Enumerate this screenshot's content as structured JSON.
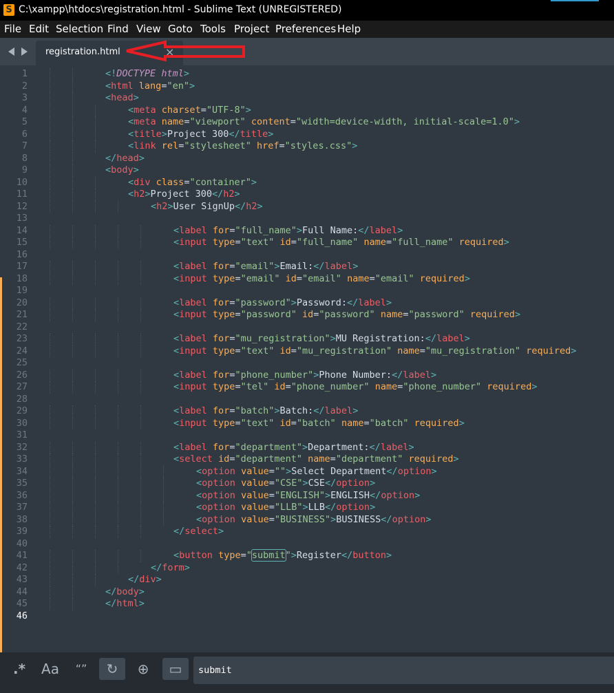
{
  "window": {
    "title": "C:\\xampp\\htdocs\\registration.html - Sublime Text (UNREGISTERED)"
  },
  "menu": [
    "File",
    "Edit",
    "Selection",
    "Find",
    "View",
    "Goto",
    "Tools",
    "Project",
    "Preferences",
    "Help"
  ],
  "tab": {
    "label": "registration.html",
    "close": "×"
  },
  "find_bar": {
    "regex": ".*",
    "case": "Aa",
    "whole_word": "“”",
    "wrap": "↻",
    "in_selection": "⊕",
    "highlight": "▭",
    "value": "submit"
  },
  "colors": {
    "background": "#303841",
    "tag": "#ec5f66",
    "attribute": "#f9ae58",
    "string": "#99c794",
    "punctuation": "#5fb4b4",
    "doctype": "#c695c6",
    "modified_marker": "#f9ae58",
    "annotation_arrow": "#e81e25"
  },
  "editor": {
    "cursor_line": 46,
    "lines": [
      {
        "n": 1,
        "i": 2,
        "h": "<span class=\"p\">&lt;!</span><span class=\"d\">DOCTYPE</span> <span class=\"d\">html</span><span class=\"p\">&gt;</span>"
      },
      {
        "n": 2,
        "i": 2,
        "h": "<span class=\"p\">&lt;</span><span class=\"t\">html</span> <span class=\"a\">lang</span>=<span class=\"s\">\"en\"</span><span class=\"p\">&gt;</span>"
      },
      {
        "n": 3,
        "i": 2,
        "h": "<span class=\"p\">&lt;</span><span class=\"t\">head</span><span class=\"p\">&gt;</span>"
      },
      {
        "n": 4,
        "i": 3,
        "h": "<span class=\"p\">&lt;</span><span class=\"t\">meta</span> <span class=\"a\">charset</span>=<span class=\"s\">\"UTF-8\"</span><span class=\"p\">&gt;</span>"
      },
      {
        "n": 5,
        "i": 3,
        "h": "<span class=\"p\">&lt;</span><span class=\"t\">meta</span> <span class=\"a\">name</span>=<span class=\"s\">\"viewport\"</span> <span class=\"a\">content</span>=<span class=\"s\">\"width=device-width, initial-scale=1.0\"</span><span class=\"p\">&gt;</span>"
      },
      {
        "n": 6,
        "i": 3,
        "h": "<span class=\"p\">&lt;</span><span class=\"t\">title</span><span class=\"p\">&gt;</span>Project 300<span class=\"p\">&lt;/</span><span class=\"t\">title</span><span class=\"p\">&gt;</span>"
      },
      {
        "n": 7,
        "i": 3,
        "h": "<span class=\"p\">&lt;</span><span class=\"t\">link</span> <span class=\"a\">rel</span>=<span class=\"s\">\"stylesheet\"</span> <span class=\"a\">href</span>=<span class=\"s\">\"styles.css\"</span><span class=\"p\">&gt;</span>"
      },
      {
        "n": 8,
        "i": 2,
        "h": "<span class=\"p\">&lt;/</span><span class=\"t\">head</span><span class=\"p\">&gt;</span>"
      },
      {
        "n": 9,
        "i": 2,
        "h": "<span class=\"p\">&lt;</span><span class=\"t\">body</span><span class=\"p\">&gt;</span>"
      },
      {
        "n": 10,
        "i": 3,
        "h": "<span class=\"p\">&lt;</span><span class=\"t\">div</span> <span class=\"a\">class</span>=<span class=\"s\">\"container\"</span><span class=\"p\">&gt;</span>"
      },
      {
        "n": 11,
        "i": 3,
        "h": "<span class=\"p\">&lt;</span><span class=\"t\">h2</span><span class=\"p\">&gt;</span>Project 300<span class=\"p\">&lt;/</span><span class=\"t\">h2</span><span class=\"p\">&gt;</span>"
      },
      {
        "n": 12,
        "i": 4,
        "h": "<span class=\"p\">&lt;</span><span class=\"t\">h2</span><span class=\"p\">&gt;</span>User SignUp<span class=\"p\">&lt;/</span><span class=\"t\">h2</span><span class=\"p\">&gt;</span>"
      },
      {
        "n": 13,
        "i": 0,
        "h": ""
      },
      {
        "n": 14,
        "i": 5,
        "h": "<span class=\"p\">&lt;</span><span class=\"t\">label</span> <span class=\"a\">for</span>=<span class=\"s\">\"full_name\"</span><span class=\"p\">&gt;</span>Full Name:<span class=\"p\">&lt;/</span><span class=\"t\">label</span><span class=\"p\">&gt;</span>"
      },
      {
        "n": 15,
        "i": 5,
        "h": "<span class=\"p\">&lt;</span><span class=\"t\">input</span> <span class=\"a\">type</span>=<span class=\"s\">\"text\"</span> <span class=\"a\">id</span>=<span class=\"s\">\"full_name\"</span> <span class=\"a\">name</span>=<span class=\"s\">\"full_name\"</span> <span class=\"a\">required</span><span class=\"p\">&gt;</span>"
      },
      {
        "n": 16,
        "i": 0,
        "h": ""
      },
      {
        "n": 17,
        "i": 5,
        "h": "<span class=\"p\">&lt;</span><span class=\"t\">label</span> <span class=\"a\">for</span>=<span class=\"s\">\"email\"</span><span class=\"p\">&gt;</span>Email:<span class=\"p\">&lt;/</span><span class=\"t\">label</span><span class=\"p\">&gt;</span>"
      },
      {
        "n": 18,
        "i": 5,
        "h": "<span class=\"p\">&lt;</span><span class=\"t\">input</span> <span class=\"a\">type</span>=<span class=\"s\">\"email\"</span> <span class=\"a\">id</span>=<span class=\"s\">\"email\"</span> <span class=\"a\">name</span>=<span class=\"s\">\"email\"</span> <span class=\"a\">required</span><span class=\"p\">&gt;</span>"
      },
      {
        "n": 19,
        "i": 0,
        "h": ""
      },
      {
        "n": 20,
        "i": 5,
        "h": "<span class=\"p\">&lt;</span><span class=\"t\">label</span> <span class=\"a\">for</span>=<span class=\"s\">\"password\"</span><span class=\"p\">&gt;</span>Password:<span class=\"p\">&lt;/</span><span class=\"t\">label</span><span class=\"p\">&gt;</span>"
      },
      {
        "n": 21,
        "i": 5,
        "h": "<span class=\"p\">&lt;</span><span class=\"t\">input</span> <span class=\"a\">type</span>=<span class=\"s\">\"password\"</span> <span class=\"a\">id</span>=<span class=\"s\">\"password\"</span> <span class=\"a\">name</span>=<span class=\"s\">\"password\"</span> <span class=\"a\">required</span><span class=\"p\">&gt;</span>"
      },
      {
        "n": 22,
        "i": 0,
        "h": ""
      },
      {
        "n": 23,
        "i": 5,
        "h": "<span class=\"p\">&lt;</span><span class=\"t\">label</span> <span class=\"a\">for</span>=<span class=\"s\">\"mu_registration\"</span><span class=\"p\">&gt;</span>MU Registration:<span class=\"p\">&lt;/</span><span class=\"t\">label</span><span class=\"p\">&gt;</span>"
      },
      {
        "n": 24,
        "i": 5,
        "h": "<span class=\"p\">&lt;</span><span class=\"t\">input</span> <span class=\"a\">type</span>=<span class=\"s\">\"text\"</span> <span class=\"a\">id</span>=<span class=\"s\">\"mu_registration\"</span> <span class=\"a\">name</span>=<span class=\"s\">\"mu_registration\"</span> <span class=\"a\">required</span><span class=\"p\">&gt;</span>"
      },
      {
        "n": 25,
        "i": 0,
        "h": ""
      },
      {
        "n": 26,
        "i": 5,
        "h": "<span class=\"p\">&lt;</span><span class=\"t\">label</span> <span class=\"a\">for</span>=<span class=\"s\">\"phone_number\"</span><span class=\"p\">&gt;</span>Phone Number:<span class=\"p\">&lt;/</span><span class=\"t\">label</span><span class=\"p\">&gt;</span>"
      },
      {
        "n": 27,
        "i": 5,
        "h": "<span class=\"p\">&lt;</span><span class=\"t\">input</span> <span class=\"a\">type</span>=<span class=\"s\">\"tel\"</span> <span class=\"a\">id</span>=<span class=\"s\">\"phone_number\"</span> <span class=\"a\">name</span>=<span class=\"s\">\"phone_number\"</span> <span class=\"a\">required</span><span class=\"p\">&gt;</span>"
      },
      {
        "n": 28,
        "i": 0,
        "h": ""
      },
      {
        "n": 29,
        "i": 5,
        "h": "<span class=\"p\">&lt;</span><span class=\"t\">label</span> <span class=\"a\">for</span>=<span class=\"s\">\"batch\"</span><span class=\"p\">&gt;</span>Batch:<span class=\"p\">&lt;/</span><span class=\"t\">label</span><span class=\"p\">&gt;</span>"
      },
      {
        "n": 30,
        "i": 5,
        "h": "<span class=\"p\">&lt;</span><span class=\"t\">input</span> <span class=\"a\">type</span>=<span class=\"s\">\"text\"</span> <span class=\"a\">id</span>=<span class=\"s\">\"batch\"</span> <span class=\"a\">name</span>=<span class=\"s\">\"batch\"</span> <span class=\"a\">required</span><span class=\"p\">&gt;</span>"
      },
      {
        "n": 31,
        "i": 0,
        "h": ""
      },
      {
        "n": 32,
        "i": 5,
        "h": "<span class=\"p\">&lt;</span><span class=\"t\">label</span> <span class=\"a\">for</span>=<span class=\"s\">\"department\"</span><span class=\"p\">&gt;</span>Department:<span class=\"p\">&lt;/</span><span class=\"t\">label</span><span class=\"p\">&gt;</span>"
      },
      {
        "n": 33,
        "i": 5,
        "h": "<span class=\"p\">&lt;</span><span class=\"t\">select</span> <span class=\"a\">id</span>=<span class=\"s\">\"department\"</span> <span class=\"a\">name</span>=<span class=\"s\">\"department\"</span> <span class=\"a\">required</span><span class=\"p\">&gt;</span>"
      },
      {
        "n": 34,
        "i": 6,
        "h": "<span class=\"p\">&lt;</span><span class=\"t\">option</span> <span class=\"a\">value</span>=<span class=\"s\">\"\"</span><span class=\"p\">&gt;</span>Select Department<span class=\"p\">&lt;/</span><span class=\"t\">option</span><span class=\"p\">&gt;</span>"
      },
      {
        "n": 35,
        "i": 6,
        "h": "<span class=\"p\">&lt;</span><span class=\"t\">option</span> <span class=\"a\">value</span>=<span class=\"s\">\"CSE\"</span><span class=\"p\">&gt;</span>CSE<span class=\"p\">&lt;/</span><span class=\"t\">option</span><span class=\"p\">&gt;</span>"
      },
      {
        "n": 36,
        "i": 6,
        "h": "<span class=\"p\">&lt;</span><span class=\"t\">option</span> <span class=\"a\">value</span>=<span class=\"s\">\"ENGLISH\"</span><span class=\"p\">&gt;</span>ENGLISH<span class=\"p\">&lt;/</span><span class=\"t\">option</span><span class=\"p\">&gt;</span>"
      },
      {
        "n": 37,
        "i": 6,
        "h": "<span class=\"p\">&lt;</span><span class=\"t\">option</span> <span class=\"a\">value</span>=<span class=\"s\">\"LLB\"</span><span class=\"p\">&gt;</span>LLB<span class=\"p\">&lt;/</span><span class=\"t\">option</span><span class=\"p\">&gt;</span>"
      },
      {
        "n": 38,
        "i": 6,
        "h": "<span class=\"p\">&lt;</span><span class=\"t\">option</span> <span class=\"a\">value</span>=<span class=\"s\">\"BUSINESS\"</span><span class=\"p\">&gt;</span>BUSINESS<span class=\"p\">&lt;/</span><span class=\"t\">option</span><span class=\"p\">&gt;</span>"
      },
      {
        "n": 39,
        "i": 5,
        "h": "<span class=\"p\">&lt;/</span><span class=\"t\">select</span><span class=\"p\">&gt;</span>"
      },
      {
        "n": 40,
        "i": 0,
        "h": ""
      },
      {
        "n": 41,
        "i": 5,
        "h": "<span class=\"p\">&lt;</span><span class=\"t\">button</span> <span class=\"a\">type</span>=<span class=\"s\">\"<span class=\"hl\">submit</span>\"</span><span class=\"p\">&gt;</span>Register<span class=\"p\">&lt;/</span><span class=\"t\">button</span><span class=\"p\">&gt;</span>"
      },
      {
        "n": 42,
        "i": 4,
        "h": "<span class=\"p\">&lt;/</span><span class=\"t\">form</span><span class=\"p\">&gt;</span>"
      },
      {
        "n": 43,
        "i": 3,
        "h": "<span class=\"p\">&lt;/</span><span class=\"t\">div</span><span class=\"p\">&gt;</span>"
      },
      {
        "n": 44,
        "i": 2,
        "h": "<span class=\"p\">&lt;/</span><span class=\"t\">body</span><span class=\"p\">&gt;</span>"
      },
      {
        "n": 45,
        "i": 2,
        "h": "<span class=\"p\">&lt;/</span><span class=\"t\">html</span><span class=\"p\">&gt;</span>"
      },
      {
        "n": 46,
        "i": 0,
        "h": ""
      }
    ]
  }
}
